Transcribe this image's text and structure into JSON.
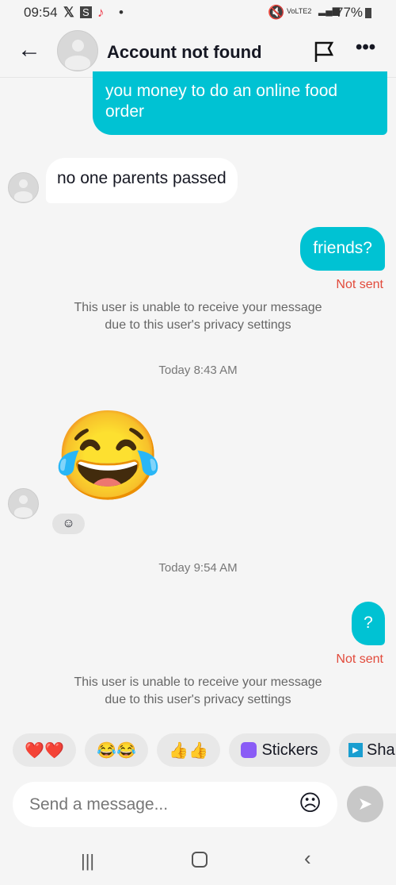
{
  "status": {
    "time": "09:54",
    "battery": "77%",
    "network": "VoLTE2"
  },
  "header": {
    "title": "Account not found"
  },
  "messages": [
    {
      "side": "out",
      "text": "you money to do an online food order"
    },
    {
      "side": "in",
      "text": "no one parents passed"
    },
    {
      "side": "out",
      "text": "friends?",
      "status": "Not sent"
    }
  ],
  "system_notice": [
    "This user is unable to receive your message",
    "due to this user's privacy settings"
  ],
  "timestamps": [
    "Today 8:43 AM",
    "Today 9:54 AM"
  ],
  "emoji_message": "😂",
  "last_message": {
    "text": "?",
    "status": "Not sent"
  },
  "quick_replies": [
    "❤️❤️",
    "😂😂",
    "👍👍",
    "Stickers",
    "Sha"
  ],
  "input": {
    "placeholder": "Send a message..."
  },
  "colors": {
    "accent": "#00c2d3",
    "error": "#e24a3b"
  }
}
